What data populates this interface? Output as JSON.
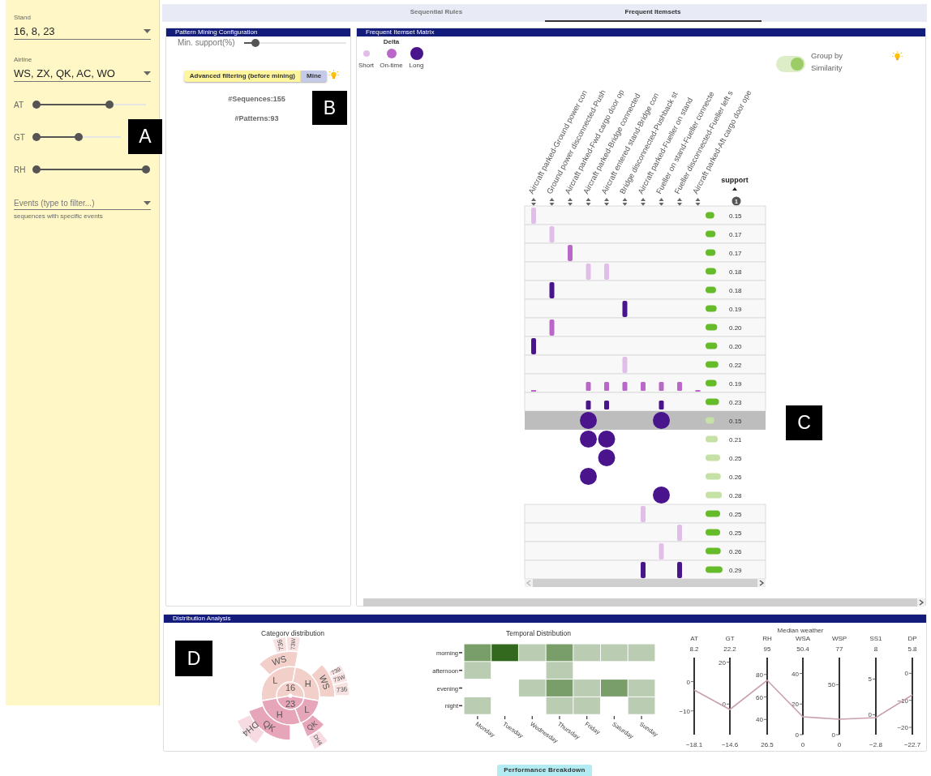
{
  "sidebar": {
    "fields": [
      {
        "label": "Stand",
        "value": "16, 8, 23"
      },
      {
        "label": "Airline",
        "value": "WS, ZX, QK, AC, WO"
      }
    ],
    "sliders": [
      {
        "label": "AT",
        "level": 0.67
      },
      {
        "label": "GT",
        "level": 0.5
      },
      {
        "label": "RH",
        "level": 1
      }
    ],
    "events": {
      "placeholder": "Events (type to filter...)",
      "helper": "sequences with specific events"
    }
  },
  "tabs": [
    {
      "label": "Sequential Rules",
      "selected": false
    },
    {
      "label": "Frequent Itemsets",
      "selected": true
    }
  ],
  "config": {
    "title": "Pattern Mining Configuration",
    "min_support": {
      "label": "Min. support(%)",
      "level": 0.11
    },
    "filter_button": "Advanced filtering (before mining)",
    "mine_button": "Mine",
    "sequences": "#Sequences:155",
    "patterns": "#Patterns:93"
  },
  "matrix": {
    "title": "Frequent Itemset Matrix",
    "legend": {
      "title": "Delta",
      "items": [
        {
          "label": "Short",
          "color": "#e1bee7"
        },
        {
          "label": "On-time",
          "color": "#ba68c8"
        },
        {
          "label": "Long",
          "color": "#4a148c"
        }
      ]
    },
    "toggle": {
      "label": "Group by Similarity",
      "on": true
    },
    "columns": [
      "Aircraft parked-Ground power con",
      "Ground power disconnected-Push",
      "Aircraft parked-Fwd cargo door op",
      "Aircraft parked-Bridge connected",
      "Aircraft entered stand-Bridge con",
      "Bridge disconnected-Pushback st",
      "Aircraft parked-Fueller on stand",
      "Fueller on stand-Fueller connecte",
      "Fueller disconnected-Fueller left s",
      "Aircraft parked-Aft cargo door ope"
    ],
    "support_header": "support",
    "sort_rank": "1",
    "rows": [
      {
        "kind": "itemset",
        "selected": false,
        "support": "0.15",
        "cells": [
          {
            "kind": "bar",
            "color": "#e1bee7"
          },
          null,
          null,
          null,
          null,
          null,
          null,
          null,
          null,
          null
        ]
      },
      {
        "kind": "itemset",
        "selected": false,
        "support": "0.17",
        "cells": [
          null,
          {
            "kind": "bar",
            "color": "#e1bee7"
          },
          null,
          null,
          null,
          null,
          null,
          null,
          null,
          null
        ]
      },
      {
        "kind": "itemset",
        "selected": false,
        "support": "0.17",
        "cells": [
          null,
          null,
          {
            "kind": "bar",
            "color": "#ba68c8"
          },
          null,
          null,
          null,
          null,
          null,
          null,
          null
        ]
      },
      {
        "kind": "itemset",
        "selected": false,
        "support": "0.18",
        "cells": [
          null,
          null,
          null,
          {
            "kind": "bar",
            "color": "#e1bee7"
          },
          {
            "kind": "bar",
            "color": "#e1bee7"
          },
          null,
          null,
          null,
          null,
          null
        ]
      },
      {
        "kind": "itemset",
        "selected": false,
        "support": "0.18",
        "cells": [
          null,
          {
            "kind": "bar",
            "color": "#4a148c"
          },
          null,
          null,
          null,
          null,
          null,
          null,
          null,
          null
        ]
      },
      {
        "kind": "itemset",
        "selected": false,
        "support": "0.19",
        "cells": [
          null,
          null,
          null,
          null,
          null,
          {
            "kind": "bar",
            "color": "#4a148c"
          },
          null,
          null,
          null,
          null
        ]
      },
      {
        "kind": "itemset",
        "selected": false,
        "support": "0.20",
        "cells": [
          null,
          {
            "kind": "bar",
            "color": "#ba68c8"
          },
          null,
          null,
          null,
          null,
          null,
          null,
          null,
          null
        ]
      },
      {
        "kind": "itemset",
        "selected": false,
        "support": "0.20",
        "cells": [
          {
            "kind": "bar",
            "color": "#4a148c"
          },
          null,
          null,
          null,
          null,
          null,
          null,
          null,
          null,
          null
        ]
      },
      {
        "kind": "itemset",
        "selected": false,
        "support": "0.22",
        "cells": [
          null,
          null,
          null,
          null,
          null,
          {
            "kind": "bar",
            "color": "#e1bee7"
          },
          null,
          null,
          null,
          null
        ]
      },
      {
        "kind": "itemset",
        "selected": false,
        "support": "0.19",
        "cells": [
          {
            "kind": "tick",
            "color": "#ba68c8"
          },
          null,
          null,
          {
            "kind": "short",
            "color": "#ba68c8"
          },
          {
            "kind": "short",
            "color": "#ba68c8"
          },
          {
            "kind": "short",
            "color": "#ba68c8"
          },
          {
            "kind": "short",
            "color": "#ba68c8"
          },
          {
            "kind": "short",
            "color": "#ba68c8"
          },
          {
            "kind": "short",
            "color": "#ba68c8"
          },
          {
            "kind": "tick",
            "color": "#ba68c8"
          }
        ]
      },
      {
        "kind": "itemset",
        "selected": false,
        "support": "0.23",
        "cells": [
          null,
          null,
          null,
          {
            "kind": "short",
            "color": "#4a148c"
          },
          {
            "kind": "short",
            "color": "#4a148c"
          },
          null,
          null,
          {
            "kind": "short",
            "color": "#4a148c"
          },
          null,
          null
        ]
      },
      {
        "kind": "group",
        "selected": true,
        "support": "0.15",
        "cells": [
          null,
          null,
          null,
          {
            "kind": "dot",
            "color": "#4a148c"
          },
          null,
          null,
          null,
          {
            "kind": "dot",
            "color": "#4a148c"
          },
          null,
          null
        ]
      },
      {
        "kind": "group",
        "selected": false,
        "support": "0.21",
        "cells": [
          null,
          null,
          null,
          {
            "kind": "dot",
            "color": "#4a148c"
          },
          {
            "kind": "dot",
            "color": "#4a148c"
          },
          null,
          null,
          null,
          null,
          null
        ]
      },
      {
        "kind": "group",
        "selected": false,
        "support": "0.25",
        "cells": [
          null,
          null,
          null,
          null,
          {
            "kind": "dot",
            "color": "#4a148c"
          },
          null,
          null,
          null,
          null,
          null
        ]
      },
      {
        "kind": "group",
        "selected": false,
        "support": "0.26",
        "cells": [
          null,
          null,
          null,
          {
            "kind": "dot",
            "color": "#4a148c"
          },
          null,
          null,
          null,
          null,
          null,
          null
        ]
      },
      {
        "kind": "group",
        "selected": false,
        "support": "0.28",
        "cells": [
          null,
          null,
          null,
          null,
          null,
          null,
          null,
          {
            "kind": "dot",
            "color": "#4a148c"
          },
          null,
          null
        ]
      },
      {
        "kind": "itemset",
        "selected": false,
        "support": "0.25",
        "cells": [
          null,
          null,
          null,
          null,
          null,
          null,
          {
            "kind": "bar",
            "color": "#e1bee7"
          },
          null,
          null,
          null
        ]
      },
      {
        "kind": "itemset",
        "selected": false,
        "support": "0.25",
        "cells": [
          null,
          null,
          null,
          null,
          null,
          null,
          null,
          null,
          {
            "kind": "bar",
            "color": "#e1bee7"
          },
          null
        ]
      },
      {
        "kind": "itemset",
        "selected": false,
        "support": "0.26",
        "cells": [
          null,
          null,
          null,
          null,
          null,
          null,
          null,
          {
            "kind": "bar",
            "color": "#e1bee7"
          },
          null,
          null
        ]
      },
      {
        "kind": "itemset",
        "selected": false,
        "support": "0.29",
        "cells": [
          null,
          null,
          null,
          null,
          null,
          null,
          {
            "kind": "bar",
            "color": "#4a148c"
          },
          null,
          {
            "kind": "bar",
            "color": "#4a148c"
          },
          null
        ]
      }
    ]
  },
  "distribution": {
    "title": "Distribution Analysis",
    "category": {
      "title": "Category distribution",
      "sunburst": [
        {
          "label": "16",
          "color": "#f2cfc9",
          "children": [
            {
              "label": "L",
              "color": "#f2cfc9",
              "children": [
                {
                  "label": "WS",
                  "color": "#f2cfc9",
                  "children": [
                    {
                      "label": "736",
                      "color": "#f8e1e1"
                    },
                    {
                      "label": "73W",
                      "color": "#f8e1e1"
                    }
                  ]
                }
              ]
            },
            {
              "label": "H",
              "color": "#f2cfc9",
              "children": [
                {
                  "label": "WS",
                  "color": "#f2cfc9",
                  "children": [
                    {
                      "label": "739",
                      "color": "#f8e1e1"
                    },
                    {
                      "label": "73W",
                      "color": "#f8e1e1"
                    },
                    {
                      "label": "736",
                      "color": "#f8e1e1"
                    }
                  ]
                }
              ]
            }
          ]
        },
        {
          "label": "23",
          "color": "#e6a5b9",
          "children": [
            {
              "label": "L",
              "color": "#e6a5b9",
              "children": [
                {
                  "label": "QK",
                  "color": "#e6a5b9",
                  "children": [
                    {
                      "label": "DH4",
                      "color": "#f6dbe2"
                    }
                  ]
                }
              ]
            },
            {
              "label": "H",
              "color": "#e6a5b9",
              "children": [
                {
                  "label": "QK",
                  "color": "#e6a5b9",
                  "children": [
                    {
                      "label": "DH4",
                      "color": "#f6dbe2"
                    }
                  ]
                }
              ]
            }
          ]
        }
      ]
    },
    "temporal": {
      "title": "Temporal Distribution",
      "days": [
        "Monday",
        "Tuesday",
        "Wednesday",
        "Thursday",
        "Friday",
        "Saturday",
        "Sunday"
      ],
      "rows": [
        {
          "label": "morning",
          "cells": [
            {
              "color": "#7a9e6a"
            },
            {
              "color": "#33691e"
            },
            {
              "color": "#bacdb3"
            },
            {
              "color": "#7a9e6a"
            },
            {
              "color": "#bacdb3"
            },
            {
              "color": "#bacdb3"
            },
            {
              "color": "#bacdb3"
            }
          ]
        },
        {
          "label": "afternoon",
          "cells": [
            {
              "color": "#bacdb3"
            },
            null,
            null,
            {
              "color": "#bacdb3"
            },
            null,
            null,
            null
          ]
        },
        {
          "label": "evening",
          "cells": [
            null,
            null,
            {
              "color": "#bacdb3"
            },
            {
              "color": "#7a9e6a"
            },
            {
              "color": "#bacdb3"
            },
            {
              "color": "#7a9e6a"
            },
            {
              "color": "#bacdb3"
            }
          ]
        },
        {
          "label": "night",
          "cells": [
            {
              "color": "#bacdb3"
            },
            null,
            null,
            {
              "color": "#bacdb3"
            },
            {
              "color": "#bacdb3"
            },
            null,
            {
              "color": "#bacdb3"
            }
          ]
        }
      ]
    },
    "weather": {
      "title": "Median weather",
      "axes": [
        {
          "name": "AT",
          "max": "8.2",
          "min": "−18.1",
          "ticks": [
            "0",
            "−10"
          ]
        },
        {
          "name": "GT",
          "max": "22.2",
          "min": "−14.6",
          "ticks": [
            "20",
            "0"
          ]
        },
        {
          "name": "RH",
          "max": "95",
          "min": "26.5",
          "ticks": [
            "80",
            "60",
            "40"
          ]
        },
        {
          "name": "WSA",
          "max": "50.4",
          "min": "0",
          "ticks": [
            "40",
            "20",
            "0"
          ]
        },
        {
          "name": "WSP",
          "max": "77",
          "min": "0",
          "ticks": [
            "50",
            "0"
          ]
        },
        {
          "name": "SS1",
          "max": "8",
          "min": "−2.8",
          "ticks": [
            "5",
            "0"
          ]
        },
        {
          "name": "DP",
          "max": "5.8",
          "min": "−22.7",
          "ticks": [
            "0",
            "−10",
            "−20"
          ]
        }
      ]
    }
  },
  "footer_button": "Performance Breakdown",
  "annotations": [
    "A",
    "B",
    "C",
    "D"
  ]
}
